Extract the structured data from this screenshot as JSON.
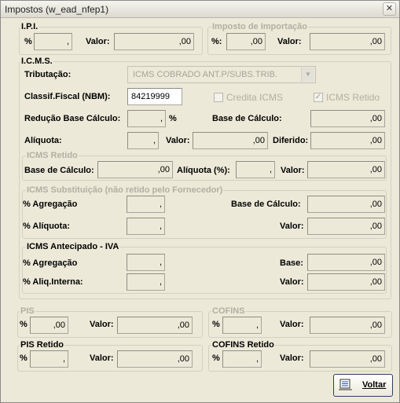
{
  "window": {
    "title": "Impostos (w_ead_nfep1)",
    "close_glyph": "✕"
  },
  "ipi": {
    "title": "I.P.I.",
    "pct_label": "%",
    "pct_value": ",",
    "valor_label": "Valor:",
    "valor_value": ",00"
  },
  "importacao": {
    "title": "Imposto de Importação",
    "pct_label": "%:",
    "pct_value": ",00",
    "valor_label": "Valor:",
    "valor_value": ",00"
  },
  "icms": {
    "title": "I.C.M.S.",
    "tributacao_label": "Tributação:",
    "tributacao_value": "ICMS COBRADO ANT.P/SUBS.TRIB.",
    "classif_label": "Classif.Fiscal (NBM):",
    "classif_value": "84219999",
    "credita_label": "Credita ICMS",
    "retido_chk_label": "ICMS Retido",
    "check_glyph": "✓",
    "reducao_label": "Redução Base Cálculo:",
    "reducao_value": ",",
    "reducao_pct": "%",
    "base_label": "Base de Cálculo:",
    "base_value": ",00",
    "aliquota_label": "Alíquota:",
    "aliquota_value": ",",
    "valor_label": "Valor:",
    "valor_value": ",00",
    "diferido_label": "Diferido:",
    "diferido_value": ",00"
  },
  "icms_retido": {
    "title": "ICMS Retido",
    "base_label": "Base de Cálculo:",
    "base_value": ",00",
    "aliquota_label": "Alíquota (%):",
    "aliquota_value": ",",
    "valor_label": "Valor:",
    "valor_value": ",00"
  },
  "icms_subst": {
    "title": "ICMS Substituição (não retido pelo Fornecedor)",
    "agregacao_label": "% Agregação",
    "agregacao_value": ",",
    "aliquota_label": "% Alíquota:",
    "aliquota_value": ",",
    "base_label": "Base de Cálculo:",
    "base_value": ",00",
    "valor_label": "Valor:",
    "valor_value": ",00"
  },
  "icms_antecipado": {
    "title": "ICMS Antecipado - IVA",
    "agregacao_label": "% Agregação",
    "agregacao_value": ",",
    "aliq_label": "% Aliq.Interna:",
    "aliq_value": ",",
    "base_label": "Base:",
    "base_value": ",00",
    "valor_label": "Valor:",
    "valor_value": ",00"
  },
  "pis": {
    "title": "PIS",
    "pct_label": "%",
    "pct_value": ",00",
    "valor_label": "Valor:",
    "valor_value": ",00"
  },
  "cofins": {
    "title": "COFINS",
    "pct_label": "%",
    "pct_value": ",",
    "valor_label": "Valor:",
    "valor_value": ",00"
  },
  "pis_retido": {
    "title": "PIS Retido",
    "pct_label": "%",
    "pct_value": ",",
    "valor_label": "Valor:",
    "valor_value": ",00"
  },
  "cofins_retido": {
    "title": "COFINS Retido",
    "pct_label": "%",
    "pct_value": ",",
    "valor_label": "Valor:",
    "valor_value": ",00"
  },
  "voltar_button": {
    "label": "Voltar",
    "icon": "document-list-icon"
  }
}
